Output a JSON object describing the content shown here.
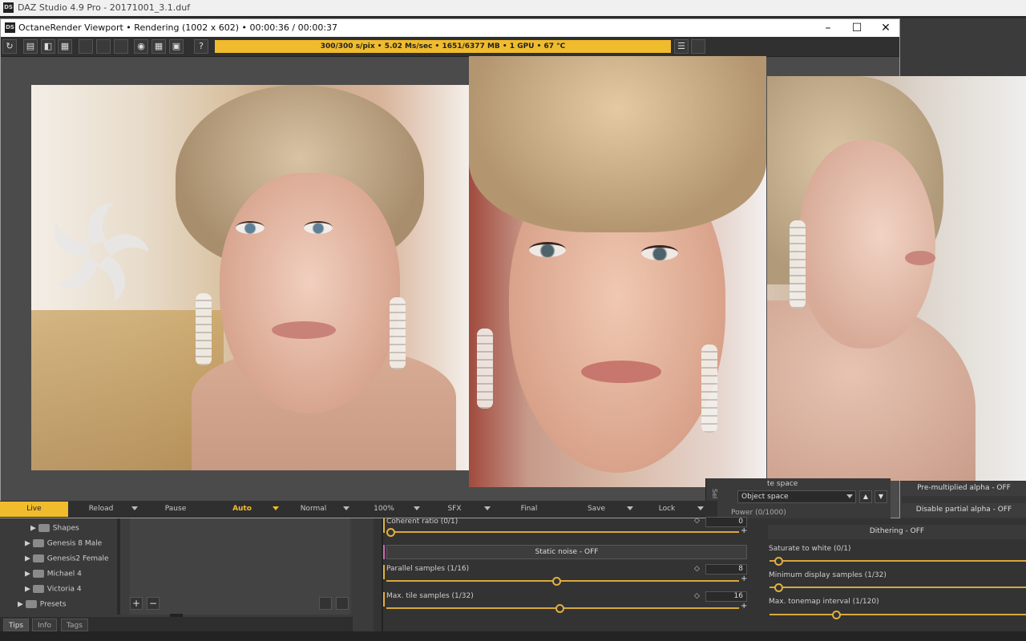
{
  "app": {
    "title": "DAZ Studio 4.9 Pro - 20171001_3.1.duf",
    "logo_text": "DS"
  },
  "viewport": {
    "title": "OctaneRender Viewport • Rendering (1002 x 602) • 00:00:36 / 00:00:37",
    "logo_text": "DS",
    "status": "300/300 s/pix • 5.02 Ms/sec • 1651/6377 MB • 1 GPU • 67 °C",
    "window_buttons": {
      "minimize": "–",
      "maximize": "☐",
      "close": "✕"
    },
    "toolbar_icons": [
      "refresh-icon",
      "region-icon",
      "pick-focus-icon",
      "pick-material-icon",
      "",
      "",
      "",
      "record-icon",
      "grid-icon",
      "image-icon",
      "help-icon"
    ],
    "toolbar_glyphs": {
      "refresh": "↻",
      "region": "▤",
      "focus": "◧",
      "material": "▦",
      "record": "◉",
      "grid": "▦",
      "image": "▣",
      "help": "?",
      "menu": "☰"
    }
  },
  "render_bar": {
    "live": "Live",
    "reload": "Reload",
    "pause": "Pause",
    "auto": "Auto",
    "normal": "Normal",
    "zoom": "100%",
    "sfx": "SFX",
    "final": "Final",
    "save": "Save",
    "lock": "Lock"
  },
  "right_top": {
    "minus": "-",
    "plus": "+",
    "zoom_fraction": 0.53
  },
  "object_panel": {
    "space_label": "te space",
    "space_value": "Object space",
    "power_label": "Power (0/1000)",
    "side_tab": "Sel",
    "up": "▲",
    "down": "▼"
  },
  "content_tree": {
    "items": [
      {
        "label": "Shapes",
        "expand": "▶"
      },
      {
        "label": "Genesis 8 Male",
        "expand": "▶"
      },
      {
        "label": "Genesis2 Female",
        "expand": "▶"
      },
      {
        "label": "Michael 4",
        "expand": "▶"
      },
      {
        "label": "Victoria 4",
        "expand": "▶"
      },
      {
        "label": "Presets",
        "expand": "▶"
      }
    ],
    "add": "+",
    "remove": "−"
  },
  "bottom_tabs": [
    "Tips",
    "Info",
    "Tags"
  ],
  "kernel_settings": {
    "coherent_ratio": {
      "label": "Coherent ratio (0/1)",
      "value": "0",
      "fraction": 0.0
    },
    "static_noise": "Static noise - OFF",
    "parallel_samples": {
      "label": "Parallel samples (1/16)",
      "value": "8",
      "fraction": 0.47
    },
    "max_tile_samples": {
      "label": "Max. tile samples (1/32)",
      "value": "16",
      "fraction": 0.48
    }
  },
  "imager_settings": {
    "premultiplied_alpha": "Pre-multiplied alpha - OFF",
    "disable_partial_alpha": "Disable partial alpha - OFF",
    "dithering": "Dithering - OFF",
    "saturate_to_white": {
      "label": "Saturate to white (0/1)",
      "fraction": 0.0
    },
    "min_display_samples": {
      "label": "Minimum display samples (1/32)",
      "fraction": 0.0
    },
    "max_tonemap_interval": {
      "label": "Max. tonemap interval (1/120)",
      "fraction": 0.25
    }
  },
  "colors": {
    "accent": "#f0bc2d",
    "panel": "#333333",
    "viewport_bg": "#4b4b4b"
  }
}
